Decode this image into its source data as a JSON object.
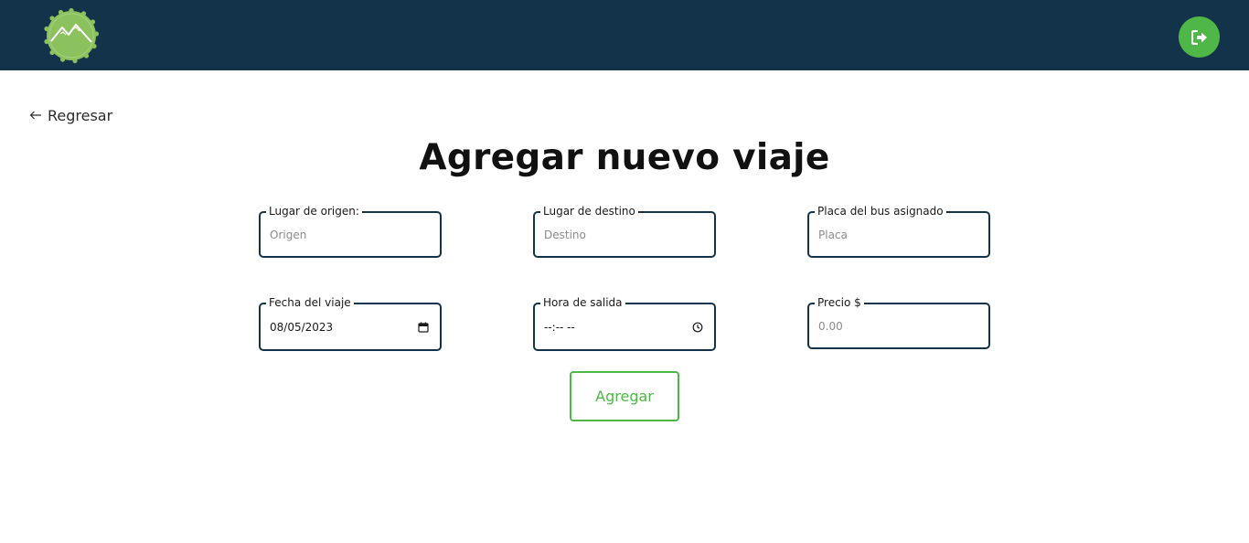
{
  "header": {
    "logo_icon": "mountain-badge-logo",
    "logout_icon": "sign-out-icon",
    "bar_color": "#13334a",
    "accent_color": "#4fb748"
  },
  "nav": {
    "back_label": "Regresar",
    "back_icon": "arrow-left-icon"
  },
  "form": {
    "title": "Agregar nuevo viaje",
    "origin": {
      "label": "Lugar de origen:",
      "placeholder": "Origen"
    },
    "destination": {
      "label": "Lugar de destino",
      "placeholder": "Destino"
    },
    "plate": {
      "label": "Placa del bus asignado",
      "placeholder": "Placa"
    },
    "date": {
      "label": "Fecha del viaje",
      "value": "08/05/2023",
      "icon": "calendar-icon"
    },
    "time": {
      "label": "Hora de salida",
      "value": "--:-- --",
      "icon": "clock-icon"
    },
    "price": {
      "label": "Precio $",
      "placeholder": "0.00"
    },
    "submit_label": "Agregar"
  }
}
